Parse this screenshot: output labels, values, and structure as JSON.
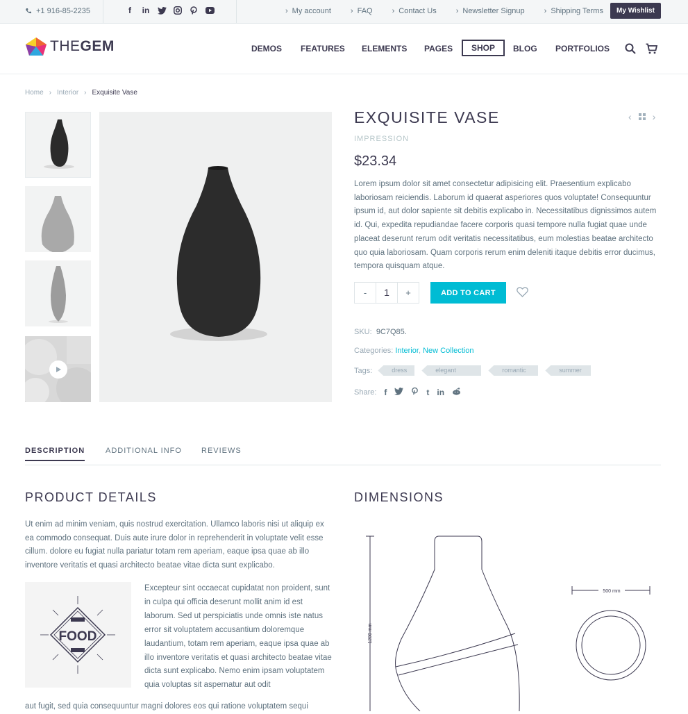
{
  "topbar": {
    "phone": "+1 916-85-2235",
    "links": [
      "My account",
      "FAQ",
      "Contact Us",
      "Newsletter Signup",
      "Shipping Terms"
    ],
    "wishlist": "My Wishlist"
  },
  "header": {
    "logo_light": "THE",
    "logo_bold": "GEM",
    "nav": [
      "DEMOS",
      "FEATURES",
      "ELEMENTS",
      "PAGES",
      "SHOP",
      "BLOG",
      "PORTFOLIOS"
    ]
  },
  "breadcrumb": {
    "home": "Home",
    "category": "Interior",
    "current": "Exquisite Vase"
  },
  "product": {
    "title": "EXQUISITE VASE",
    "subtitle": "IMPRESSION",
    "price": "$23.34",
    "description": "Lorem ipsum dolor sit amet consectetur adipisicing elit. Praesentium explicabo laboriosam reiciendis. Laborum id quaerat asperiores quos voluptate! Consequuntur ipsum id, aut dolor sapiente sit debitis explicabo in. Necessitatibus dignissimos autem id. Qui, expedita repudiandae facere corporis quasi tempore nulla fugiat quae unde placeat deserunt rerum odit veritatis necessitatibus, eum molestias beatae architecto quo quia laboriosam. Quam corporis rerum enim deleniti itaque debitis error ducimus, tempora quisquam atque.",
    "qty_minus": "-",
    "qty_value": "1",
    "qty_plus": "+",
    "add_to_cart": "ADD TO CART",
    "sku_label": "SKU:",
    "sku": "9C7Q85.",
    "categories_label": "Categories:",
    "category1": "Interior",
    "category2": "New Collection",
    "tags_label": "Tags:",
    "tags": [
      "dress",
      "elegant",
      "romantic",
      "summer"
    ],
    "share_label": "Share:"
  },
  "tabs": [
    "DESCRIPTION",
    "ADDITIONAL INFO",
    "REVIEWS"
  ],
  "details": {
    "heading": "PRODUCT DETAILS",
    "para1": "Ut enim ad minim veniam, quis nostrud exercitation. Ullamco laboris nisi ut aliquip ex ea commodo consequat. Duis aute irure dolor in reprehenderit in voluptate velit esse cillum. dolore eu fugiat nulla pariatur totam rem aperiam, eaque ipsa quae ab illo inventore veritatis et quasi architecto beatae vitae dicta sunt explicabo.",
    "para2": "Excepteur sint occaecat cupidatat non proident, sunt in culpa qui officia deserunt mollit anim id est laborum. Sed ut perspiciatis unde omnis iste natus error sit voluptatem accusantium doloremque laudantium, totam rem aperiam, eaque ipsa quae ab illo inventore veritatis et quasi architecto beatae vitae dicta sunt explicabo. Nemo enim ipsam voluptatem quia voluptas sit aspernatur aut odit",
    "para3": "aut fugit, sed quia consequuntur magni dolores eos qui ratione voluptatem sequi",
    "food_label": "FOOD"
  },
  "dimensions": {
    "heading": "DIMENSIONS",
    "height_label": "1200 mm",
    "width_label": "500 mm"
  },
  "colors": {
    "accent": "#00bcd4",
    "dark": "#3c3950",
    "text": "#5f727f"
  }
}
